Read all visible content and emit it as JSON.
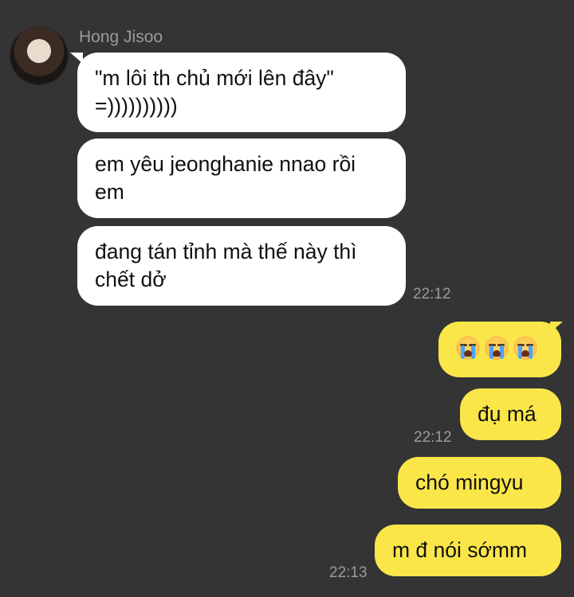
{
  "chat": {
    "sender_name": "Hong Jisoo",
    "incoming": [
      {
        "text": "\"m lôi th chủ mới lên đây\" =))))))))))"
      },
      {
        "text": "em yêu jeonghanie nnao rồi em"
      },
      {
        "text": "đang tán tỉnh mà thế này thì chết dở"
      }
    ],
    "incoming_time": "22:12",
    "outgoing": [
      {
        "text": "😭😭😭"
      },
      {
        "text": "đụ má"
      },
      {
        "text": "chó mingyu"
      },
      {
        "text": "m đ nói sớmm"
      }
    ],
    "outgoing_time_1": "22:12",
    "outgoing_time_2": "22:13"
  },
  "colors": {
    "background": "#333433",
    "incoming_bubble": "#ffffff",
    "outgoing_bubble": "#fbe64a",
    "meta_text": "#9a9b9a"
  }
}
